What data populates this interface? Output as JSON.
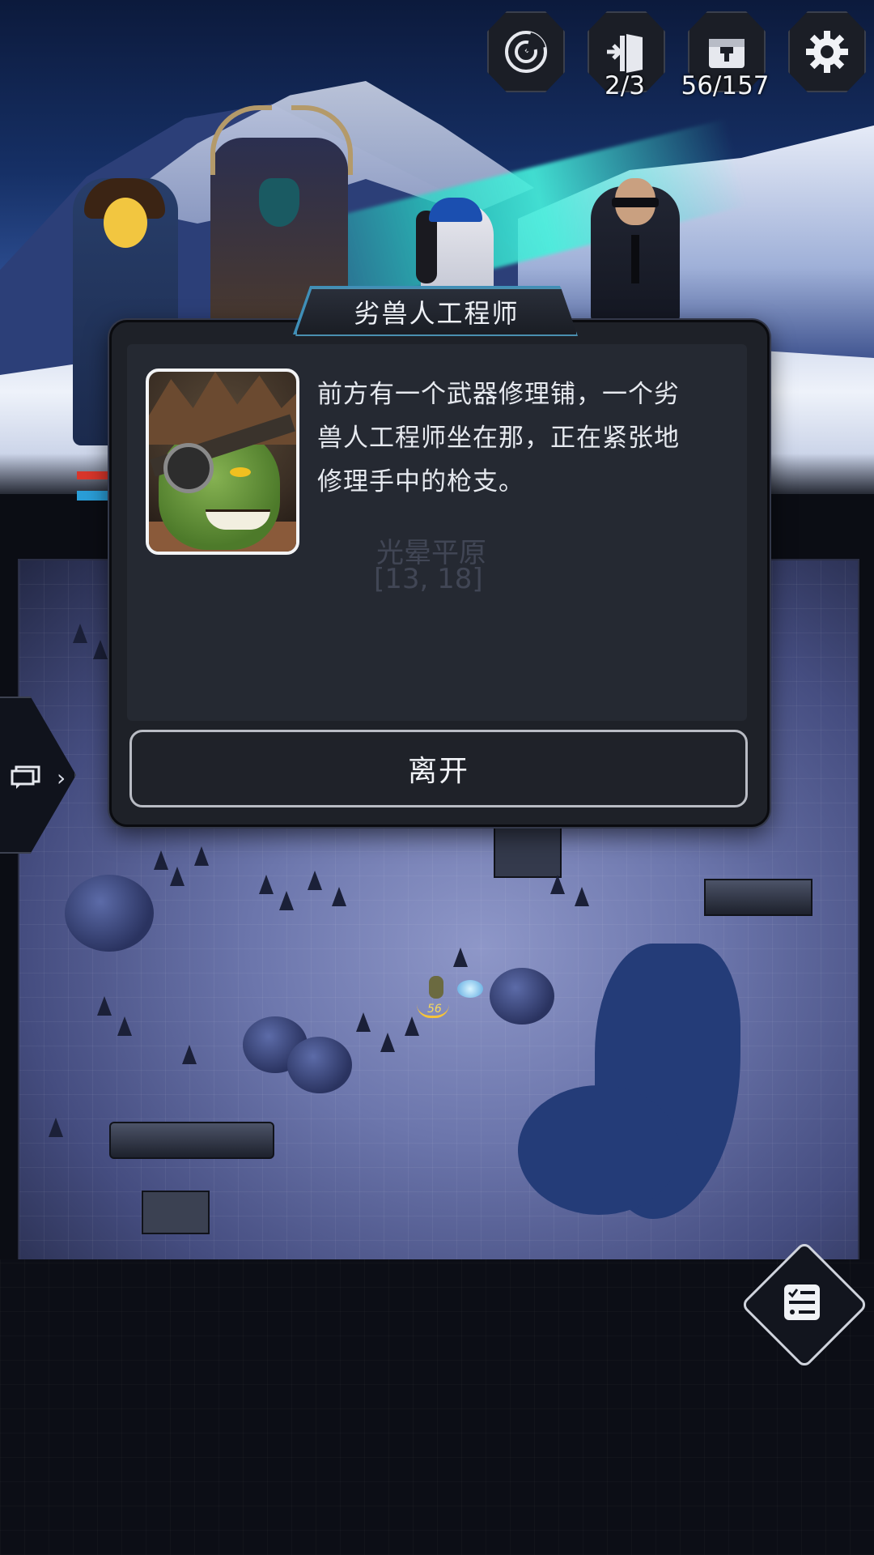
{
  "hud": {
    "buttons": [
      {
        "icon": "radar-icon"
      },
      {
        "icon": "exit-door-icon",
        "count": "2/3"
      },
      {
        "icon": "inventory-chest-icon",
        "count": "56/157"
      },
      {
        "icon": "gear-icon"
      }
    ]
  },
  "map": {
    "player_level": "56",
    "location_name": "光晕平原",
    "coordinates": "[13, 18]"
  },
  "dialog": {
    "title": "劣兽人工程师",
    "text": "前方有一个武器修理铺，一个劣\n兽人工程师坐在那，正在紧张地\n修理手中的枪支。",
    "leave_label": "离开"
  },
  "colors": {
    "title_border": "#3f8fb8",
    "hp": "#d9362b",
    "energy": "#2a9ed8",
    "background": "#0b0d14"
  }
}
